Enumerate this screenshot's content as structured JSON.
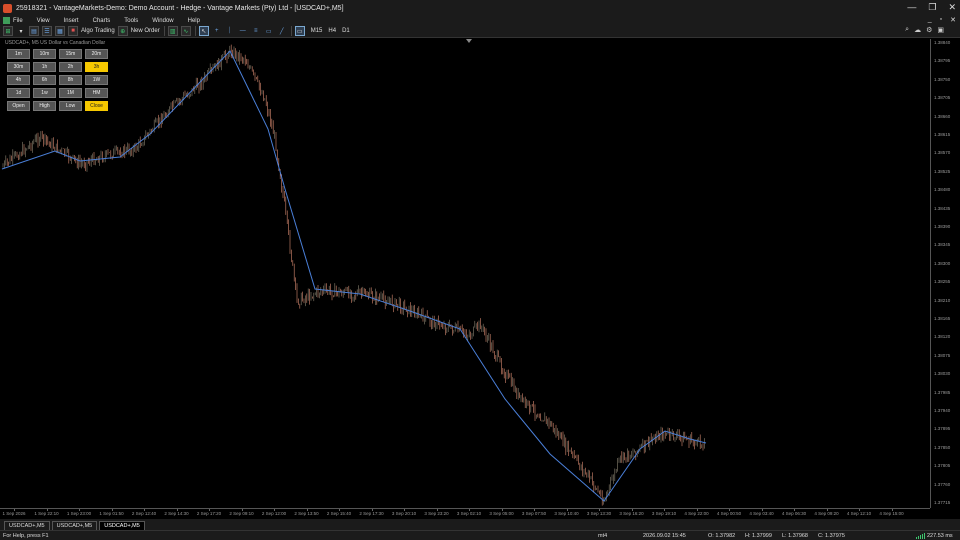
{
  "window": {
    "title": "25918321 - VantageMarkets-Demo: Demo Account - Hedge - Vantage Markets (Pty) Ltd - [USDCAD+,M5]",
    "controls": [
      "—",
      "❐",
      "✕"
    ]
  },
  "menu": {
    "items": [
      "File",
      "View",
      "Insert",
      "Charts",
      "Tools",
      "Window",
      "Help"
    ],
    "doc_controls": [
      "_",
      "▫",
      "✕"
    ]
  },
  "toolbar": {
    "algo_trading_label": "Algo Trading",
    "new_order_label": "New Order",
    "timeframes": [
      "M15",
      "H4",
      "D1"
    ]
  },
  "chart": {
    "info_label": "USDCAD+, M5  US Dollar vs Canadian Dollar",
    "timeframe_buttons": [
      {
        "label": "1m",
        "active": false
      },
      {
        "label": "10m",
        "active": false
      },
      {
        "label": "15m",
        "active": false
      },
      {
        "label": "20m",
        "active": false
      },
      {
        "label": "30m",
        "active": false
      },
      {
        "label": "1h",
        "active": false
      },
      {
        "label": "2h",
        "active": false
      },
      {
        "label": "3h",
        "active": true
      },
      {
        "label": "4h",
        "active": false
      },
      {
        "label": "6h",
        "active": false
      },
      {
        "label": "8h",
        "active": false
      },
      {
        "label": "1W",
        "active": false
      },
      {
        "label": "1d",
        "active": false
      },
      {
        "label": "1w",
        "active": false
      },
      {
        "label": "1M",
        "active": false
      },
      {
        "label": "HM",
        "active": false
      },
      {
        "label": "Open",
        "active": false
      },
      {
        "label": "High",
        "active": false
      },
      {
        "label": "Low",
        "active": false
      },
      {
        "label": "Close",
        "active": true
      }
    ],
    "price_labels": [
      "1.38840",
      "1.38795",
      "1.38750",
      "1.38705",
      "1.38660",
      "1.38615",
      "1.38570",
      "1.38525",
      "1.38480",
      "1.38435",
      "1.38390",
      "1.38345",
      "1.38300",
      "1.38255",
      "1.38210",
      "1.38165",
      "1.38120",
      "1.38075",
      "1.38030",
      "1.37985",
      "1.37940",
      "1.37895",
      "1.37850",
      "1.37805",
      "1.37760",
      "1.37715"
    ],
    "time_labels": [
      "1 Sep 2026",
      "1 Sep 22:10",
      "1 Sep 23:00",
      "1 Sep 01:50",
      "2 Sep 12:40",
      "2 Sep 14:30",
      "2 Sep 17:20",
      "2 Sep 09:10",
      "2 Sep 12:00",
      "2 Sep 13:50",
      "2 Sep 15:40",
      "2 Sep 17:30",
      "3 Sep 20:10",
      "3 Sep 23:20",
      "3 Sep 02:10",
      "3 Sep 05:00",
      "3 Sep 07:50",
      "3 Sep 10:40",
      "3 Sep 13:30",
      "3 Sep 16:20",
      "3 Sep 19:10",
      "4 Sep 22:00",
      "4 Sep 00:50",
      "4 Sep 03:40",
      "4 Sep 06:30",
      "4 Sep 09:20",
      "4 Sep 12:10",
      "4 Sep 15:00"
    ],
    "colors": {
      "bull": "#8a8270",
      "bear": "#d88a70",
      "zigzag": "#4a7fd8",
      "background": "#000000"
    }
  },
  "tabs": [
    "USDCAD+,M5",
    "USDCAD+,M5",
    "USDCAD+,M5"
  ],
  "status": {
    "help": "For Help, press F1",
    "profile": "mt4",
    "datetime": "2026.09.02 15:45",
    "open": "O: 1.37982",
    "high": "H: 1.37999",
    "low": "L: 1.37968",
    "close": "C: 1.37975",
    "connection": "227.53 ms"
  }
}
